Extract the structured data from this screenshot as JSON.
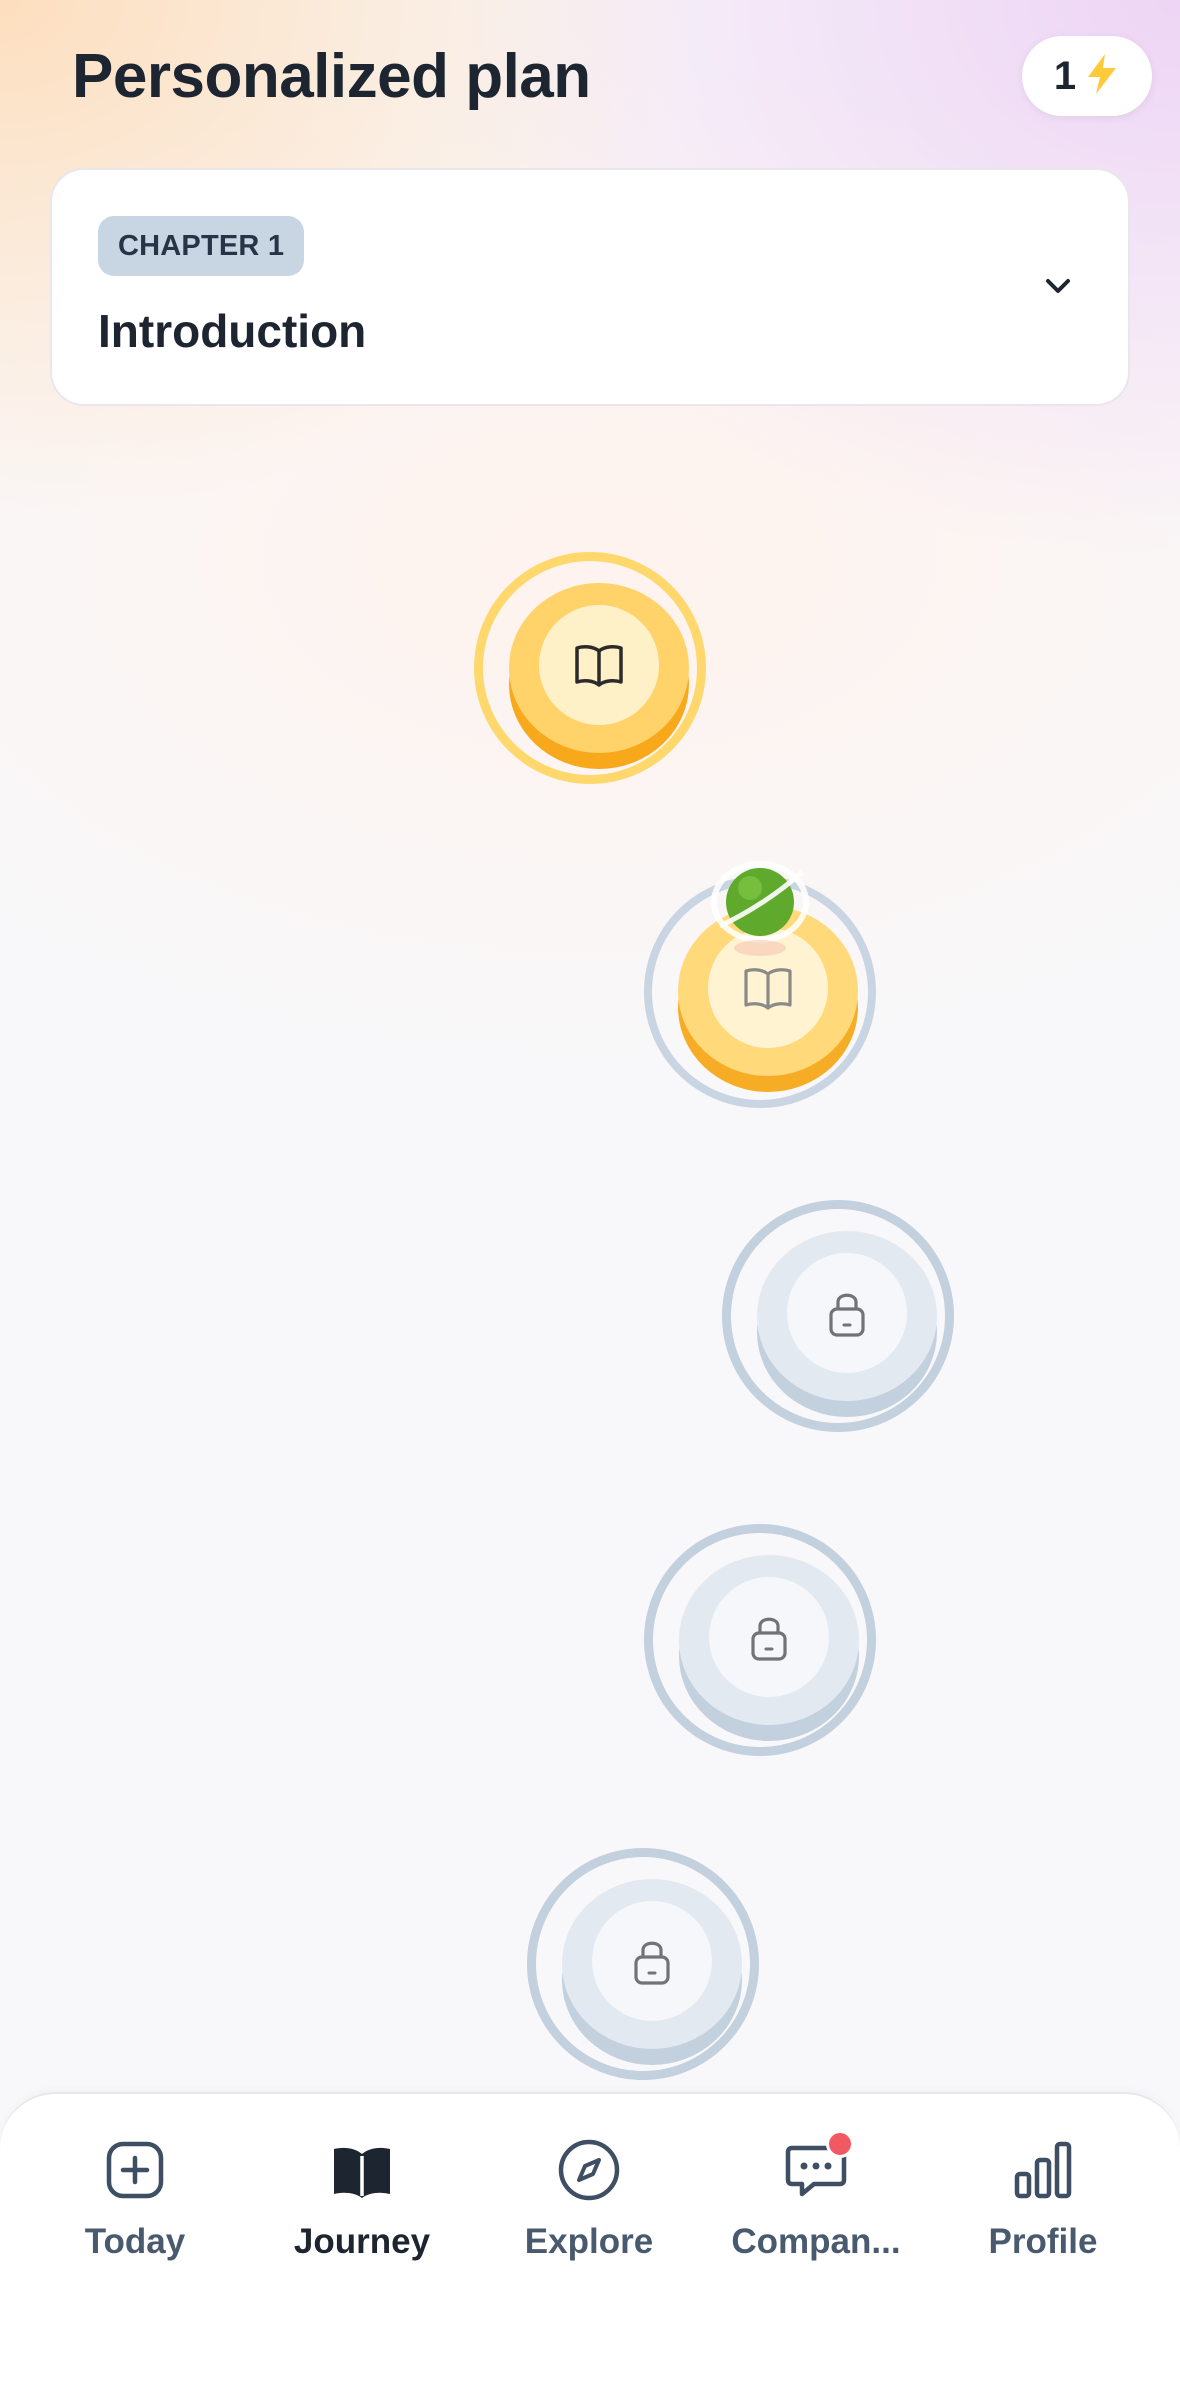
{
  "header": {
    "title": "Personalized plan",
    "streak_count": "1",
    "streak_icon": "lightning-icon"
  },
  "chapter": {
    "tag": "CHAPTER 1",
    "title": "Introduction",
    "expand_icon": "chevron-down-icon"
  },
  "path": {
    "nodes": [
      {
        "state": "completed",
        "icon": "book-icon"
      },
      {
        "state": "current",
        "icon": "book-icon"
      },
      {
        "state": "locked",
        "icon": "lock-icon"
      },
      {
        "state": "locked",
        "icon": "lock-icon"
      },
      {
        "state": "locked",
        "icon": "lock-icon"
      }
    ]
  },
  "nav": {
    "items": [
      {
        "label": "Today",
        "icon": "plus-square-icon",
        "active": false
      },
      {
        "label": "Journey",
        "icon": "book-icon",
        "active": true
      },
      {
        "label": "Explore",
        "icon": "compass-icon",
        "active": false
      },
      {
        "label": "Compan...",
        "icon": "chat-bubble-icon",
        "active": false,
        "notification": true
      },
      {
        "label": "Profile",
        "icon": "bar-chart-icon",
        "active": false
      }
    ]
  },
  "colors": {
    "gold": "#ffd36a",
    "gold_dark": "#f7a81b",
    "locked": "#c3d0de",
    "notification": "#f25a63",
    "text": "#1d2530"
  }
}
